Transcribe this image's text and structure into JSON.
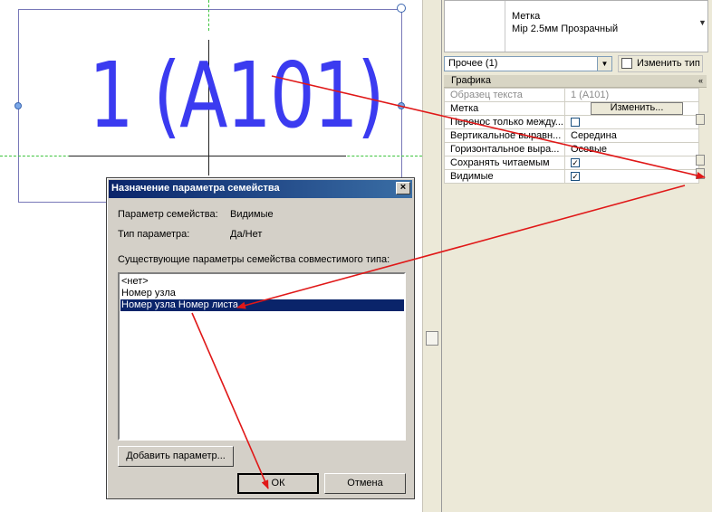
{
  "canvas": {
    "tag_text": "1 (A101)"
  },
  "properties": {
    "type_selector": {
      "line1": "Метка",
      "line2": "Мір 2.5мм Прозрачный"
    },
    "category_combo": "Прочее (1)",
    "edit_type_label": "Изменить тип",
    "group_label": "Графика",
    "group_toggle": "«",
    "rows": [
      {
        "name": "Образец текста",
        "value": "1 (A101)"
      },
      {
        "name": "Метка",
        "button": "Изменить..."
      },
      {
        "name": "Перенос только между..."
      },
      {
        "name": "Вертикальное выравн...",
        "value": "Середина"
      },
      {
        "name": "Горизонтальное выра...",
        "value": "Осевые"
      },
      {
        "name": "Сохранять читаемым"
      },
      {
        "name": "Видимые"
      }
    ]
  },
  "dialog": {
    "title": "Назначение параметра семейства",
    "close_label": "×",
    "param_label": "Параметр семейства:",
    "param_value": "Видимые",
    "type_label": "Тип параметра:",
    "type_value": "Да/Нет",
    "existing_label": "Существующие параметры семейства совместимого типа:",
    "list": [
      "<нет>",
      "Номер узла",
      "Номер узла Номер листа"
    ],
    "add_button": "Добавить параметр...",
    "ok_button": "ОК",
    "cancel_button": "Отмена"
  },
  "colors": {
    "tag_text": "#3b3bf0",
    "arrow": "#e01818",
    "selection": "#0a246a"
  }
}
